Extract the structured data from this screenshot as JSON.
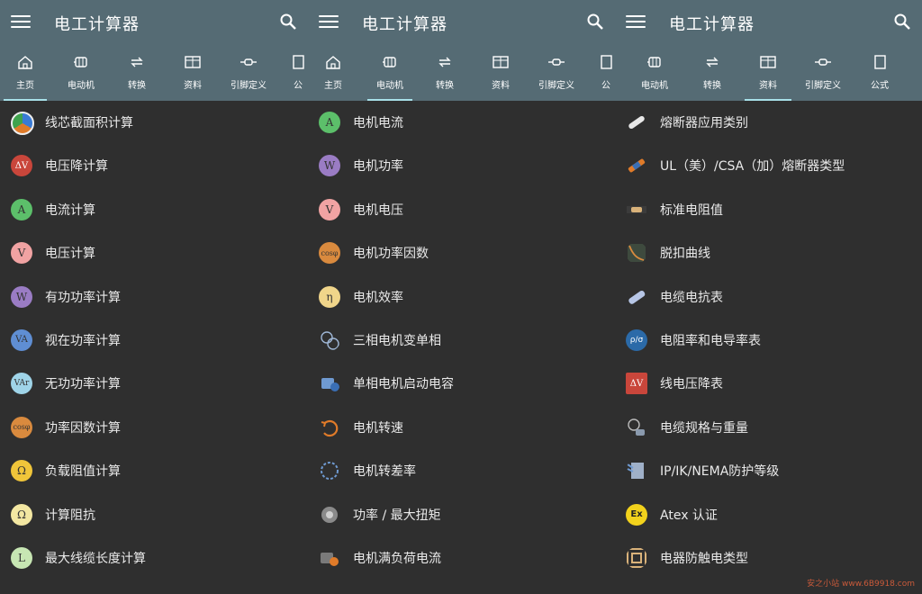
{
  "app_title": "电工计算器",
  "tabs": {
    "home": "主页",
    "motor": "电动机",
    "convert": "转换",
    "data": "资料",
    "pin": "引脚定义",
    "formula": "公式",
    "formula_short": "公"
  },
  "panels": [
    {
      "active_tab": "home",
      "items": [
        {
          "label": "线芯截面积计算",
          "icon": "wire-cross-section-icon"
        },
        {
          "label": "电压降计算",
          "icon": "voltage-drop-icon"
        },
        {
          "label": "电流计算",
          "icon": "current-icon"
        },
        {
          "label": "电压计算",
          "icon": "voltage-icon"
        },
        {
          "label": "有功功率计算",
          "icon": "active-power-icon"
        },
        {
          "label": "视在功率计算",
          "icon": "apparent-power-icon"
        },
        {
          "label": "无功功率计算",
          "icon": "reactive-power-icon"
        },
        {
          "label": "功率因数计算",
          "icon": "power-factor-icon"
        },
        {
          "label": "负载阻值计算",
          "icon": "load-resistance-icon"
        },
        {
          "label": "计算阻抗",
          "icon": "impedance-icon"
        },
        {
          "label": "最大线缆长度计算",
          "icon": "max-cable-length-icon"
        }
      ]
    },
    {
      "active_tab": "motor",
      "items": [
        {
          "label": "电机电流",
          "icon": "motor-current-icon"
        },
        {
          "label": "电机功率",
          "icon": "motor-power-icon"
        },
        {
          "label": "电机电压",
          "icon": "motor-voltage-icon"
        },
        {
          "label": "电机功率因数",
          "icon": "motor-power-factor-icon"
        },
        {
          "label": "电机效率",
          "icon": "motor-efficiency-icon"
        },
        {
          "label": "三相电机变单相",
          "icon": "three-to-single-phase-icon"
        },
        {
          "label": "单相电机启动电容",
          "icon": "start-capacitor-icon"
        },
        {
          "label": "电机转速",
          "icon": "motor-speed-icon"
        },
        {
          "label": "电机转差率",
          "icon": "motor-slip-icon"
        },
        {
          "label": "功率 / 最大扭矩",
          "icon": "max-torque-icon"
        },
        {
          "label": "电机满负荷电流",
          "icon": "full-load-current-icon"
        }
      ]
    },
    {
      "active_tab": "data",
      "items": [
        {
          "label": "熔断器应用类别",
          "icon": "fuse-category-icon"
        },
        {
          "label": "UL（美）/CSA（加）熔断器类型",
          "icon": "fuse-type-icon"
        },
        {
          "label": "标准电阻值",
          "icon": "resistor-icon"
        },
        {
          "label": "脱扣曲线",
          "icon": "trip-curve-icon"
        },
        {
          "label": "电缆电抗表",
          "icon": "cable-reactance-icon"
        },
        {
          "label": "电阻率和电导率表",
          "icon": "resistivity-icon"
        },
        {
          "label": "线电压降表",
          "icon": "line-voltage-drop-icon"
        },
        {
          "label": "电缆规格与重量",
          "icon": "cable-weight-icon"
        },
        {
          "label": "IP/IK/NEMA防护等级",
          "icon": "protection-rating-icon"
        },
        {
          "label": "Atex 认证",
          "icon": "atex-icon"
        },
        {
          "label": "电器防触电类型",
          "icon": "shock-protection-icon"
        }
      ]
    }
  ],
  "avatar_text": {
    "dv": "ΔV",
    "a": "A",
    "v": "V",
    "w": "W",
    "va": "VA",
    "var": "VAr",
    "cos": "cosφ",
    "ohm": "Ω",
    "l": "L",
    "eta": "η",
    "pv": "ρ/σ",
    "ex": "Ex"
  },
  "watermark": "安之小站 www.6B9918.com",
  "colors": {
    "appbar": "#556b74",
    "background": "#2f2f2f",
    "tab_indicator": "#a7e0e8",
    "text": "#eaeaea"
  }
}
